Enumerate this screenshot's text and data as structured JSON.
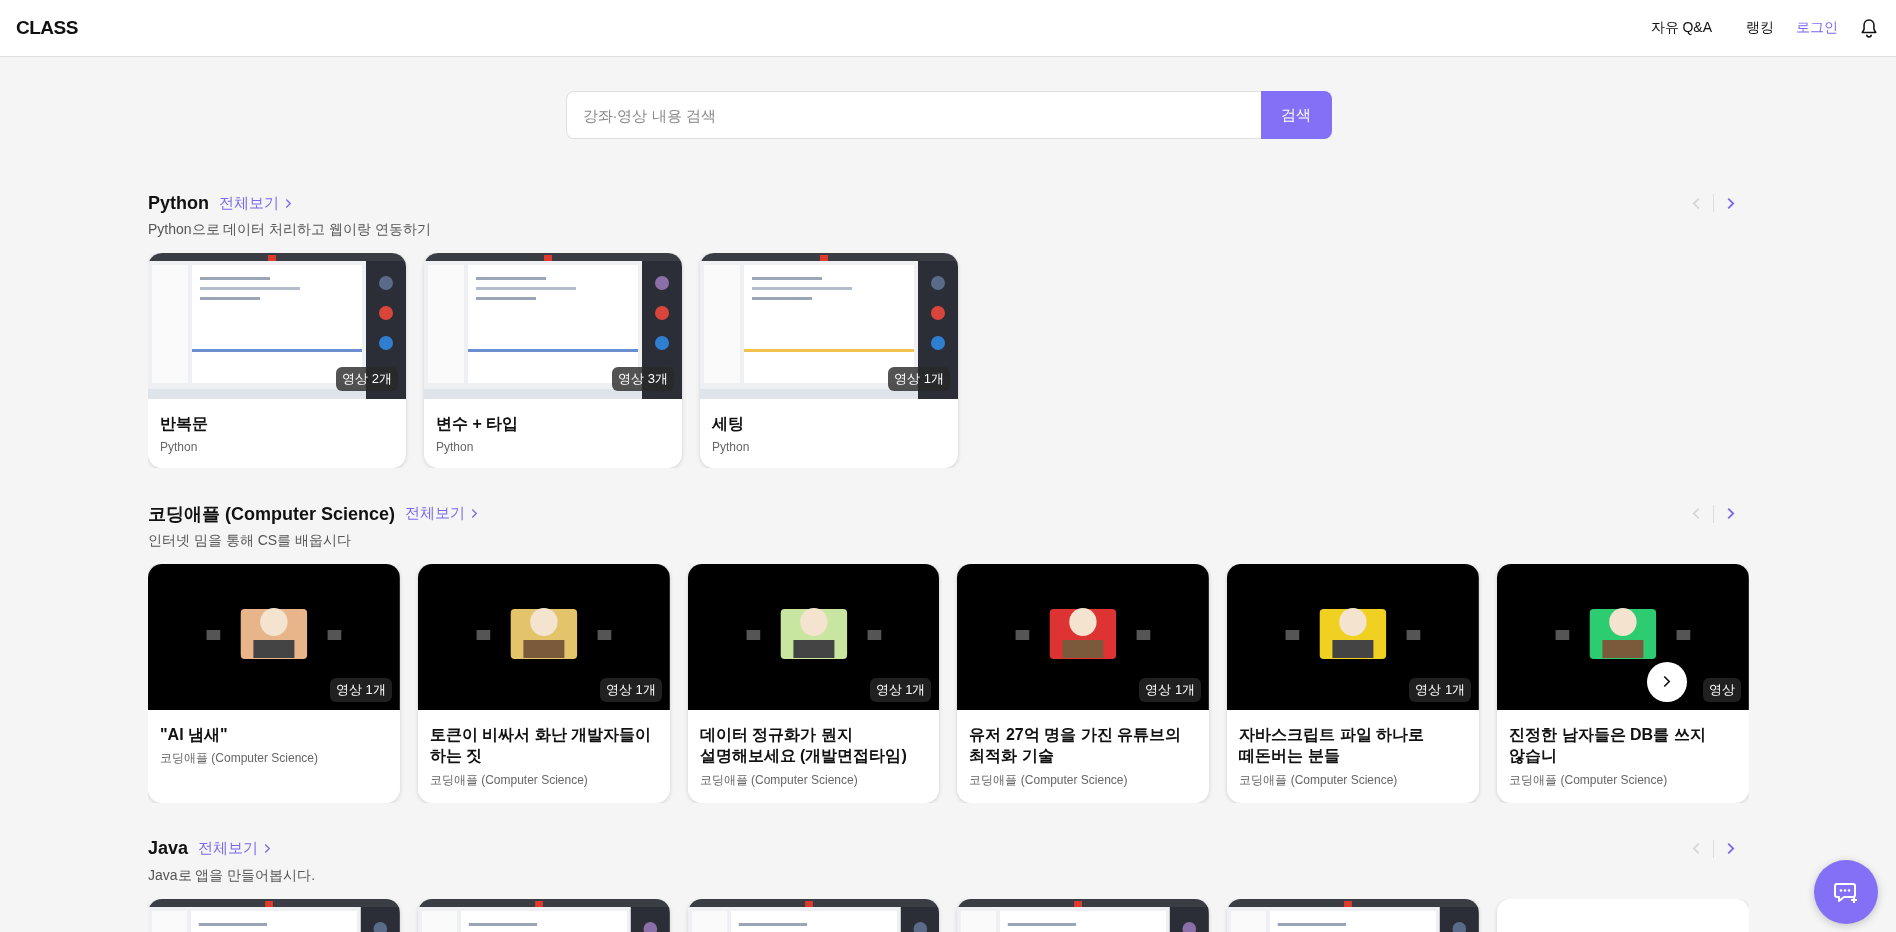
{
  "header": {
    "logo": "CLASS",
    "nav": [
      {
        "label": "자유 Q&A",
        "kind": "plain"
      },
      {
        "label": "랭킹",
        "kind": "plain"
      },
      {
        "label": "로그인",
        "kind": "accent"
      }
    ]
  },
  "search": {
    "placeholder": "강좌·영상 내용 검색",
    "button": "검색"
  },
  "sections": [
    {
      "title": "Python",
      "link": "전체보기",
      "description": "Python으로 데이터 처리하고 웹이랑 연동하기",
      "prev_disabled": true,
      "next_disabled": false,
      "cards": [
        {
          "kind": "screen",
          "title": "반복문",
          "category": "Python",
          "badge": "영상 2개"
        },
        {
          "kind": "screen",
          "title": "변수 + 타입",
          "category": "Python",
          "badge": "영상 3개"
        },
        {
          "kind": "screen",
          "title": "세팅",
          "category": "Python",
          "badge": "영상 1개"
        }
      ]
    },
    {
      "title": "코딩애플 (Computer Science)",
      "link": "전체보기",
      "description": "인터넷 밈을 통해 CS를 배웁시다",
      "prev_disabled": true,
      "next_disabled": false,
      "overlay_next": true,
      "cards": [
        {
          "kind": "dark",
          "title": "\"AI 냄새\"",
          "category": "코딩애플 (Computer Science)",
          "badge": "영상 1개"
        },
        {
          "kind": "dark",
          "title": "토큰이 비싸서 화난 개발자들이 하는 짓",
          "category": "코딩애플 (Computer Science)",
          "badge": "영상 1개"
        },
        {
          "kind": "dark",
          "title": "데이터 정규화가 뭔지 설명해보세요 (개발면접타임)",
          "category": "코딩애플 (Computer Science)",
          "badge": "영상 1개"
        },
        {
          "kind": "dark",
          "title": "유저 27억 명을 가진 유튜브의 최적화 기술",
          "category": "코딩애플 (Computer Science)",
          "badge": "영상 1개"
        },
        {
          "kind": "dark",
          "title": "자바스크립트 파일 하나로 떼돈버는 분들",
          "category": "코딩애플 (Computer Science)",
          "badge": "영상 1개"
        },
        {
          "kind": "dark",
          "title": "진정한 남자들은 DB를 쓰지 않습니",
          "category": "코딩애플 (Computer Science)",
          "badge": "영상"
        }
      ]
    },
    {
      "title": "Java",
      "link": "전체보기",
      "description": "Java로 앱을 만들어봅시다.",
      "prev_disabled": true,
      "next_disabled": false,
      "cards": [
        {
          "kind": "screen"
        },
        {
          "kind": "screen"
        },
        {
          "kind": "screen"
        },
        {
          "kind": "screen"
        },
        {
          "kind": "screen"
        },
        {
          "kind": "blank"
        }
      ]
    }
  ]
}
